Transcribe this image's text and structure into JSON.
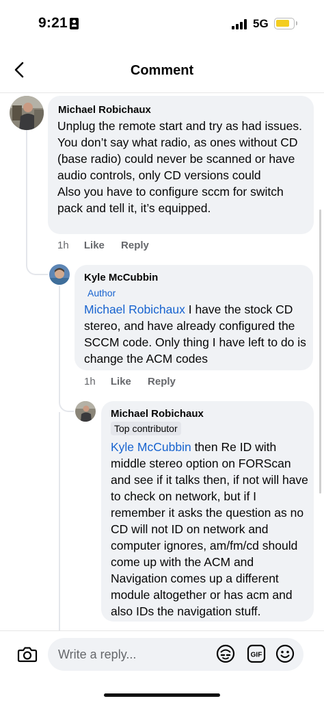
{
  "status_bar": {
    "time": "9:21",
    "network": "5G",
    "battery_color": "#f4cd1e"
  },
  "header": {
    "back_icon": "chevron-left-icon",
    "title": "Comment"
  },
  "comments": [
    {
      "author": "Michael Robichaux",
      "text": "Unplug the remote start and try as had issues.\nYou don’t say what radio, as ones without CD (base radio) could never be scanned or have audio controls, only CD versions could\nAlso you have to configure sccm for switch pack and tell it, it’s equipped.",
      "time": "1h",
      "like": "Like",
      "reply": "Reply"
    },
    {
      "author": "Kyle McCubbin",
      "badge": "Author",
      "mention": "Michael Robichaux",
      "text": " I have the stock CD stereo, and have already configured the SCCM code. Only thing I have left to do is change the ACM codes",
      "time": "1h",
      "like": "Like",
      "reply": "Reply"
    },
    {
      "author": "Michael Robichaux",
      "badge": "Top contributor",
      "mention": "Kyle McCubbin",
      "text": " then Re ID with middle stereo option on FORScan and see if it talks then, if not will have to check on network, but if I remember it asks the question as no CD will not ID on network and computer ignores, am/fm/cd should come up with the ACM and Navigation comes up a different module altogether or has acm and also IDs the navigation stuff."
    }
  ],
  "reply_bar": {
    "placeholder": "Write a reply...",
    "icons": [
      "camera-icon",
      "avatar-sticker-icon",
      "gif-icon",
      "emoji-icon"
    ]
  },
  "colors": {
    "link": "#1763cf",
    "bubble": "#f0f2f5",
    "meta": "#65676b"
  }
}
